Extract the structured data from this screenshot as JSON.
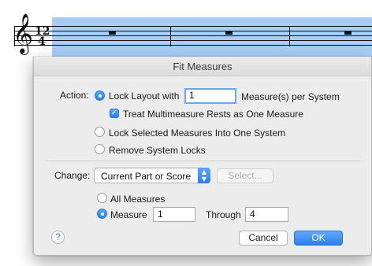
{
  "score": {
    "clef_icon": "treble-clef-icon",
    "time_signature": {
      "top": "12",
      "bottom": "4"
    },
    "highlight_color": "#a9ccf4"
  },
  "dialog": {
    "title": "Fit Measures",
    "action": {
      "label": "Action:",
      "lock_layout_label": "Lock Layout with",
      "lock_layout_value": "1",
      "per_system_label": "Measure(s) per System",
      "multimeasure_checkbox_label": "Treat Multimeasure Rests as One Measure",
      "multimeasure_checked": true,
      "lock_selected_label": "Lock Selected Measures Into One System",
      "remove_locks_label": "Remove System Locks",
      "selected_option": "Lock Layout with"
    },
    "change": {
      "label": "Change:",
      "scope_value": "Current Part or Score",
      "select_button": "Select...",
      "all_measures_label": "All Measures",
      "measure_label": "Measure",
      "measure_from": "1",
      "through_label": "Through",
      "measure_to": "4",
      "selected_option": "Measure"
    },
    "help_label": "?",
    "cancel_label": "Cancel",
    "ok_label": "OK"
  },
  "colors": {
    "accent": "#2a7ee8",
    "dialog_background": "#ececec"
  }
}
